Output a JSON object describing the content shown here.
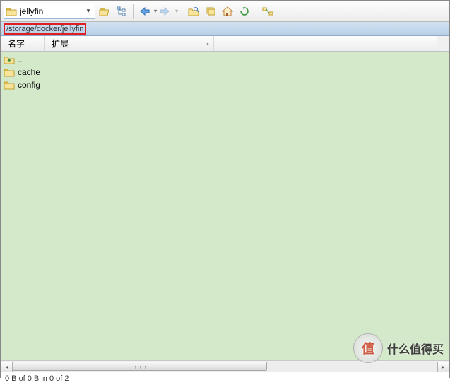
{
  "toolbar": {
    "current_folder": "jellyfin"
  },
  "address_bar": {
    "path": "/storage/docker/jellyfin"
  },
  "columns": {
    "name": "名字",
    "ext": "扩展"
  },
  "files": [
    {
      "name": "..",
      "type": "up"
    },
    {
      "name": "cache",
      "type": "folder"
    },
    {
      "name": "config",
      "type": "folder"
    }
  ],
  "status": {
    "text": "0 B of 0 B in 0 of 2"
  },
  "watermark": {
    "symbol": "值",
    "text": "什么值得买"
  },
  "icons": {
    "folder_open": "folder-open",
    "tree": "tree",
    "back": "back",
    "forward": "forward",
    "new_folder": "new-folder",
    "copy": "copy",
    "home": "home",
    "refresh": "refresh",
    "sync": "sync"
  }
}
